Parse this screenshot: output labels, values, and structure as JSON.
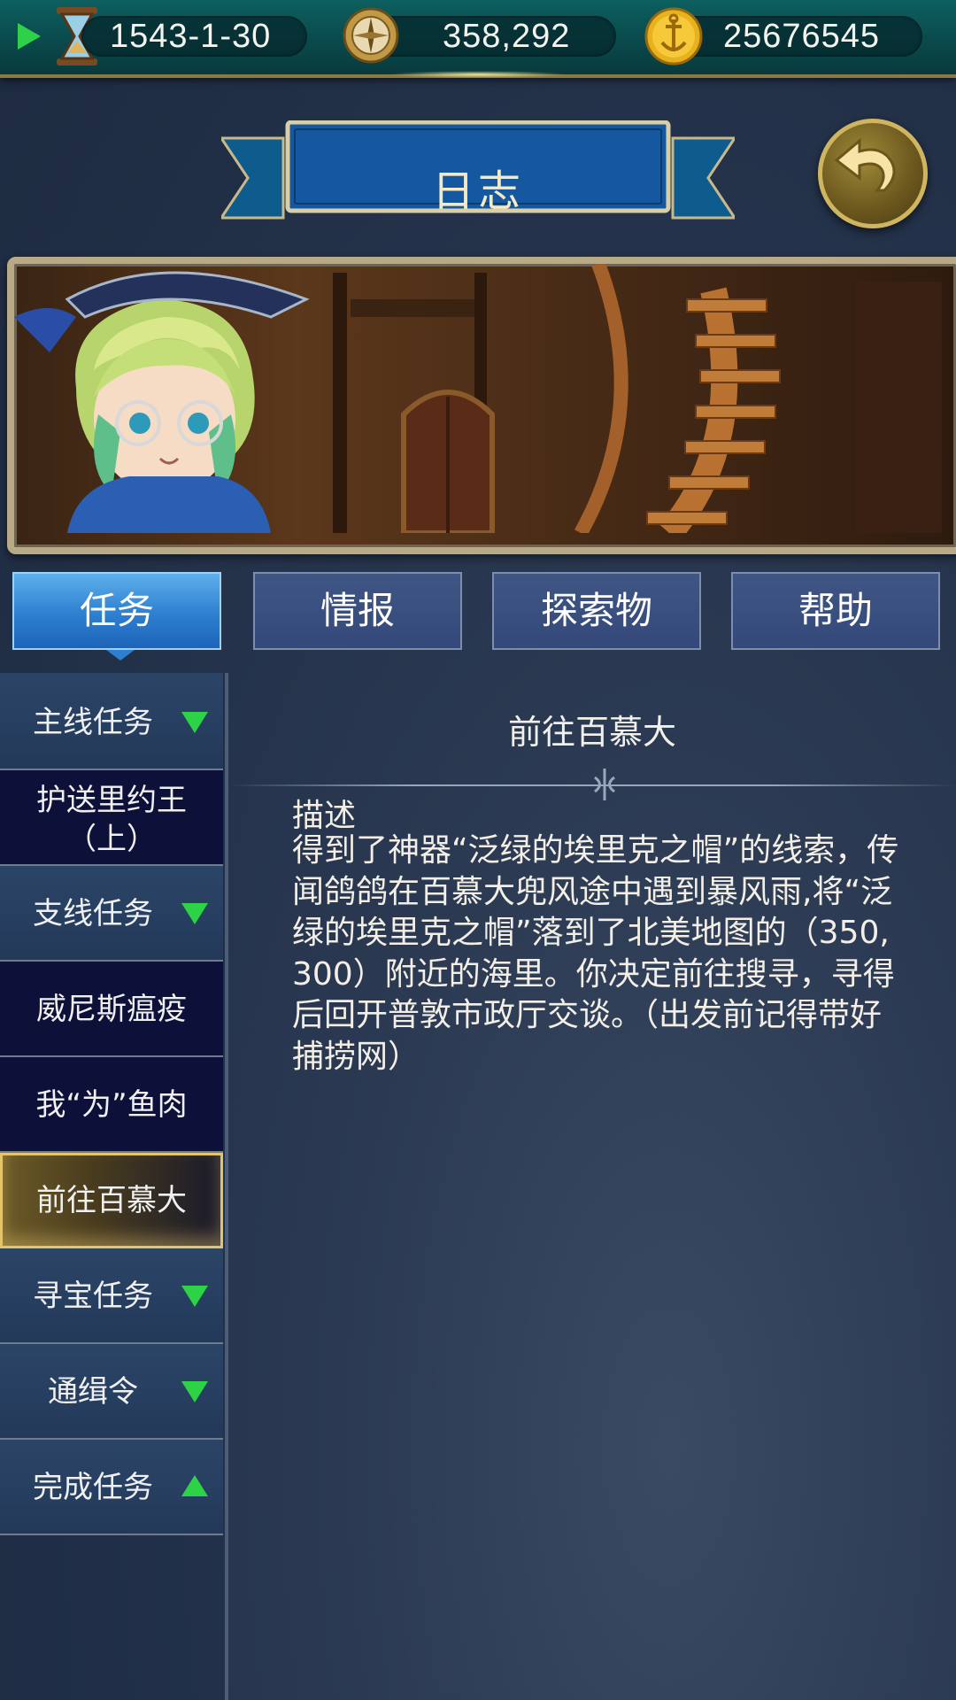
{
  "topbar": {
    "date": "1543-1-30",
    "compass_value": "358,292",
    "gold": "25676545"
  },
  "banner": {
    "title": "日志"
  },
  "tabs": [
    {
      "label": "任务",
      "active": true
    },
    {
      "label": "情报",
      "active": false
    },
    {
      "label": "探索物",
      "active": false
    },
    {
      "label": "帮助",
      "active": false
    }
  ],
  "sidebar": {
    "items": [
      {
        "label": "主线任务",
        "type": "category",
        "arrow": "down"
      },
      {
        "label": "护送里约王（上）",
        "type": "quest"
      },
      {
        "label": "支线任务",
        "type": "category",
        "arrow": "down"
      },
      {
        "label": "威尼斯瘟疫",
        "type": "quest"
      },
      {
        "label": "我“为”鱼肉",
        "type": "quest"
      },
      {
        "label": "前往百慕大",
        "type": "quest",
        "selected": true
      },
      {
        "label": "寻宝任务",
        "type": "category",
        "arrow": "down"
      },
      {
        "label": "通缉令",
        "type": "category",
        "arrow": "down"
      },
      {
        "label": "完成任务",
        "type": "category",
        "arrow": "up"
      }
    ]
  },
  "detail": {
    "title": "前往百慕大",
    "heading": "描述",
    "body": "得到了神器“泛绿的埃里克之帽”的线索，传闻鸽鸽在百慕大兜风途中遇到暴风雨,将“泛绿的埃里克之帽”落到了北美地图的（350,300）附近的海里。你决定前往搜寻，寻得后回开普敦市政厅交谈。（出发前记得带好捕捞网）"
  },
  "colors": {
    "accent_green": "#2ed246",
    "tab_active": "#2d7fd0",
    "gold_frame": "#e3c46a"
  }
}
